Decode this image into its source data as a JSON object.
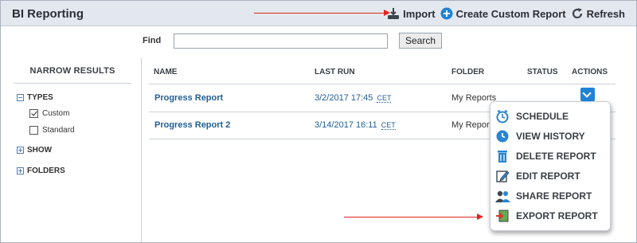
{
  "header": {
    "title": "BI Reporting",
    "actions": [
      {
        "label": "Import",
        "icon": "import-icon"
      },
      {
        "label": "Create Custom Report",
        "icon": "plus-circle-icon"
      },
      {
        "label": "Refresh",
        "icon": "refresh-icon"
      }
    ]
  },
  "find": {
    "label": "Find",
    "value": "",
    "placeholder": "",
    "button_label": "Search"
  },
  "narrow": {
    "title": "NARROW RESULTS",
    "types_label": "TYPES",
    "types": [
      {
        "label": "Custom",
        "checked": true
      },
      {
        "label": "Standard",
        "checked": false
      }
    ],
    "show_label": "SHOW",
    "folders_label": "FOLDERS"
  },
  "table": {
    "columns": [
      "NAME",
      "LAST RUN",
      "FOLDER",
      "STATUS",
      "ACTIONS"
    ],
    "rows": [
      {
        "name": "Progress Report",
        "last_run": "3/2/2017 17:45",
        "tz": "CET",
        "folder": "My Reports",
        "status": ""
      },
      {
        "name": "Progress Report 2",
        "last_run": "3/14/2017 16:11",
        "tz": "CET",
        "folder": "My Repor",
        "status": ""
      }
    ]
  },
  "actions_menu": {
    "items": [
      {
        "label": "SCHEDULE",
        "icon": "clock-icon"
      },
      {
        "label": "VIEW HISTORY",
        "icon": "history-icon"
      },
      {
        "label": "DELETE REPORT",
        "icon": "trash-icon"
      },
      {
        "label": "EDIT REPORT",
        "icon": "edit-icon"
      },
      {
        "label": "SHARE REPORT",
        "icon": "share-users-icon"
      },
      {
        "label": "EXPORT REPORT",
        "icon": "export-icon"
      }
    ]
  },
  "colors": {
    "header_bg": "#e3e8ef",
    "link": "#1f5f96",
    "accent": "#1f83d6",
    "annotation_arrow": "#e02424"
  }
}
